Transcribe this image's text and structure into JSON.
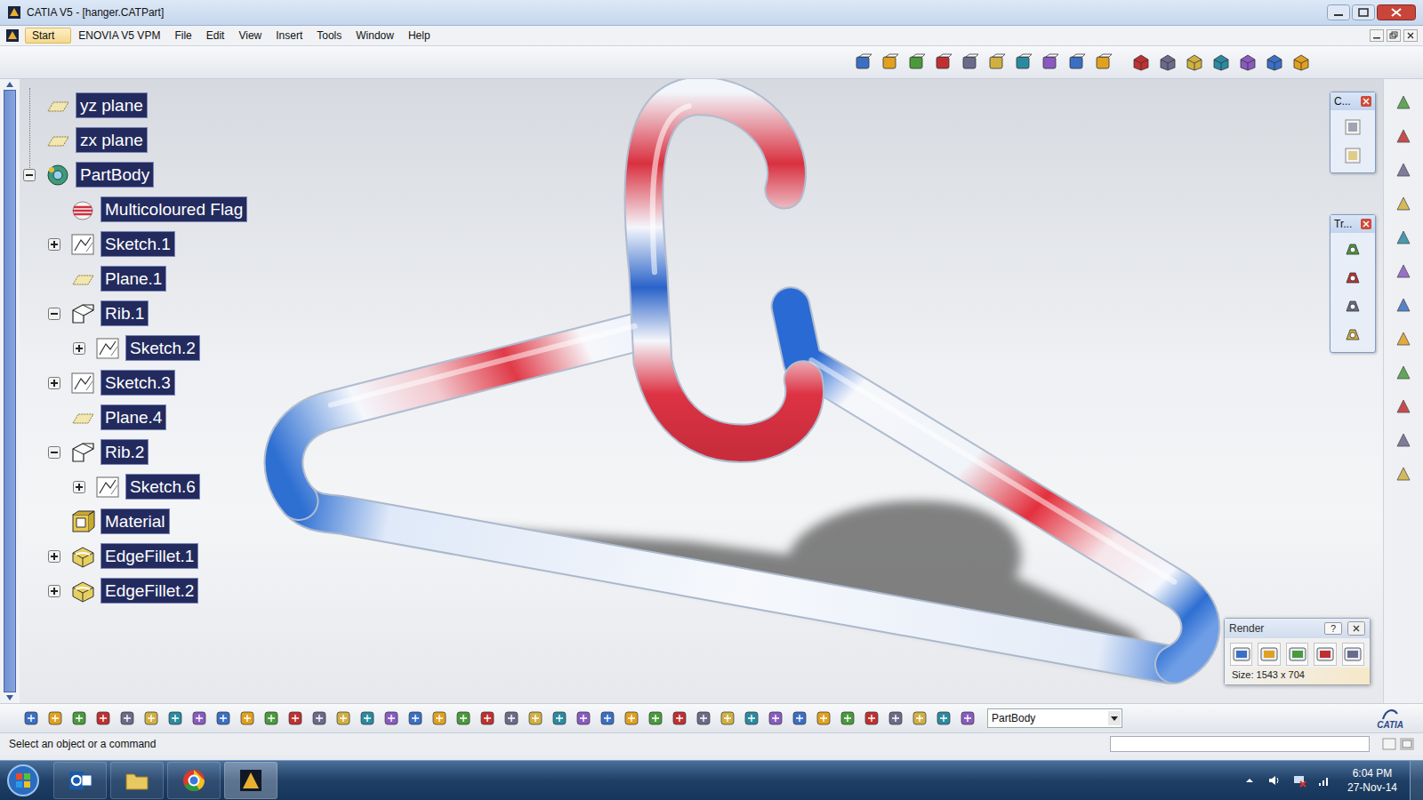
{
  "window": {
    "title": "CATIA V5 - [hanger.CATPart]"
  },
  "menu": [
    {
      "label": "Start",
      "highlighted": true
    },
    {
      "label": "ENOVIA V5 VPM",
      "highlighted": false
    },
    {
      "label": "File",
      "highlighted": false
    },
    {
      "label": "Edit",
      "highlighted": false
    },
    {
      "label": "View",
      "highlighted": false
    },
    {
      "label": "Insert",
      "highlighted": false
    },
    {
      "label": "Tools",
      "highlighted": false
    },
    {
      "label": "Window",
      "highlighted": false
    },
    {
      "label": "Help",
      "highlighted": false
    }
  ],
  "tree": [
    {
      "label": "yz plane",
      "depth": 0,
      "kind": "plane",
      "expandable": false,
      "expanded": false
    },
    {
      "label": "zx plane",
      "depth": 0,
      "kind": "plane",
      "expandable": false,
      "expanded": false
    },
    {
      "label": "PartBody",
      "depth": 0,
      "kind": "body",
      "expandable": true,
      "expanded": true
    },
    {
      "label": "Multicoloured Flag",
      "depth": 1,
      "kind": "flag",
      "expandable": false,
      "expanded": false
    },
    {
      "label": "Sketch.1",
      "depth": 1,
      "kind": "sketch",
      "expandable": true,
      "expanded": false
    },
    {
      "label": "Plane.1",
      "depth": 1,
      "kind": "plane",
      "expandable": false,
      "expanded": false
    },
    {
      "label": "Rib.1",
      "depth": 1,
      "kind": "rib",
      "expandable": true,
      "expanded": true
    },
    {
      "label": "Sketch.2",
      "depth": 2,
      "kind": "sketch",
      "expandable": true,
      "expanded": false
    },
    {
      "label": "Sketch.3",
      "depth": 1,
      "kind": "sketch",
      "expandable": true,
      "expanded": false
    },
    {
      "label": "Plane.4",
      "depth": 1,
      "kind": "plane",
      "expandable": false,
      "expanded": false
    },
    {
      "label": "Rib.2",
      "depth": 1,
      "kind": "rib",
      "expandable": true,
      "expanded": true
    },
    {
      "label": "Sketch.6",
      "depth": 2,
      "kind": "sketch",
      "expandable": true,
      "expanded": false
    },
    {
      "label": "Material",
      "depth": 1,
      "kind": "material",
      "expandable": false,
      "expanded": false
    },
    {
      "label": "EdgeFillet.1",
      "depth": 1,
      "kind": "fillet",
      "expandable": true,
      "expanded": false
    },
    {
      "label": "EdgeFillet.2",
      "depth": 1,
      "kind": "fillet",
      "expandable": true,
      "expanded": false
    }
  ],
  "floating_toolbars": [
    {
      "title": "C..."
    },
    {
      "title": "Tr..."
    }
  ],
  "render_panel": {
    "title": "Render",
    "help": "?",
    "size": "Size: 1543 x 704"
  },
  "part_selector": {
    "value": "PartBody"
  },
  "status_bar": {
    "message": "Select an object or a command"
  },
  "brand": "CATIA",
  "taskbar": {
    "time": "6:04 PM",
    "date": "27-Nov-14"
  }
}
